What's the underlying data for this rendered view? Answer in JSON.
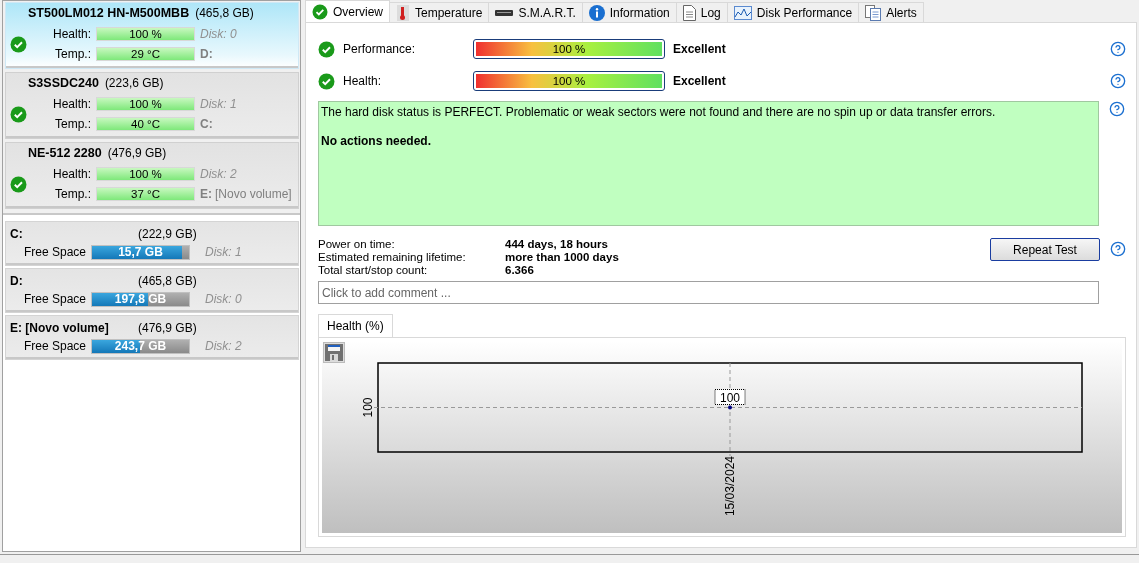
{
  "disks": [
    {
      "name": "ST500LM012 HN-M500MBB",
      "size": "(465,8 GB)",
      "selected": true,
      "health_label": "Health:",
      "health": "100 %",
      "temp_label": "Temp.:",
      "temp": "29 °C",
      "disk": "Disk: 0",
      "drive": "D:"
    },
    {
      "name": "S3SSDC240",
      "size": "(223,6 GB)",
      "selected": false,
      "health_label": "Health:",
      "health": "100 %",
      "temp_label": "Temp.:",
      "temp": "40 °C",
      "disk": "Disk: 1",
      "drive": "C:"
    },
    {
      "name": "NE-512 2280",
      "size": "(476,9 GB)",
      "selected": false,
      "health_label": "Health:",
      "health": "100 %",
      "temp_label": "Temp.:",
      "temp": "37 °C",
      "disk": "Disk: 2",
      "drive": "E:",
      "volume": "[Novo volume]"
    }
  ],
  "volumes": [
    {
      "name": "C:",
      "size": "(222,9 GB)",
      "label": "Free Space",
      "free": "15,7 GB",
      "level": 0.93,
      "disk": "Disk: 1"
    },
    {
      "name": "D:",
      "size": "(465,8 GB)",
      "label": "Free Space",
      "free": "197,8 GB",
      "level": 0.575,
      "disk": "Disk: 0"
    },
    {
      "name": "E: [Novo volume]",
      "size": "(476,9 GB)",
      "label": "Free Space",
      "free": "243,7 GB",
      "level": 0.49,
      "disk": "Disk: 2"
    }
  ],
  "tabs": [
    {
      "label": "Overview",
      "selected": true
    },
    {
      "label": "Temperature",
      "selected": false
    },
    {
      "label": "S.M.A.R.T.",
      "selected": false
    },
    {
      "label": "Information",
      "selected": false
    },
    {
      "label": "Log",
      "selected": false
    },
    {
      "label": "Disk Performance",
      "selected": false
    },
    {
      "label": "Alerts",
      "selected": false
    }
  ],
  "ratings": [
    {
      "label": "Performance:",
      "reading": "100 %",
      "level": 1,
      "verdict": "Excellent"
    },
    {
      "label": "Health:",
      "reading": "100 %",
      "level": 1,
      "verdict": "Excellent"
    }
  ],
  "status_message": {
    "text": "The hard disk status is PERFECT. Problematic or weak sectors were not found and there are no spin up or data transfer errors.",
    "action": "No actions needed."
  },
  "stats": [
    {
      "label": "Power on time:",
      "value": "444 days, 18 hours"
    },
    {
      "label": "Estimated remaining lifetime:",
      "value": "more than 1000 days"
    },
    {
      "label": "Total start/stop count:",
      "value": "6.366"
    }
  ],
  "repeat_button": "Repeat Test",
  "comment": {
    "placeholder": "Click to add comment ..."
  },
  "chart_tabs": [
    {
      "label": "Health (%)",
      "selected": true
    }
  ],
  "health_chart": {
    "y_label": "100",
    "x_label": "15/03/2024",
    "point_label": "100"
  }
}
